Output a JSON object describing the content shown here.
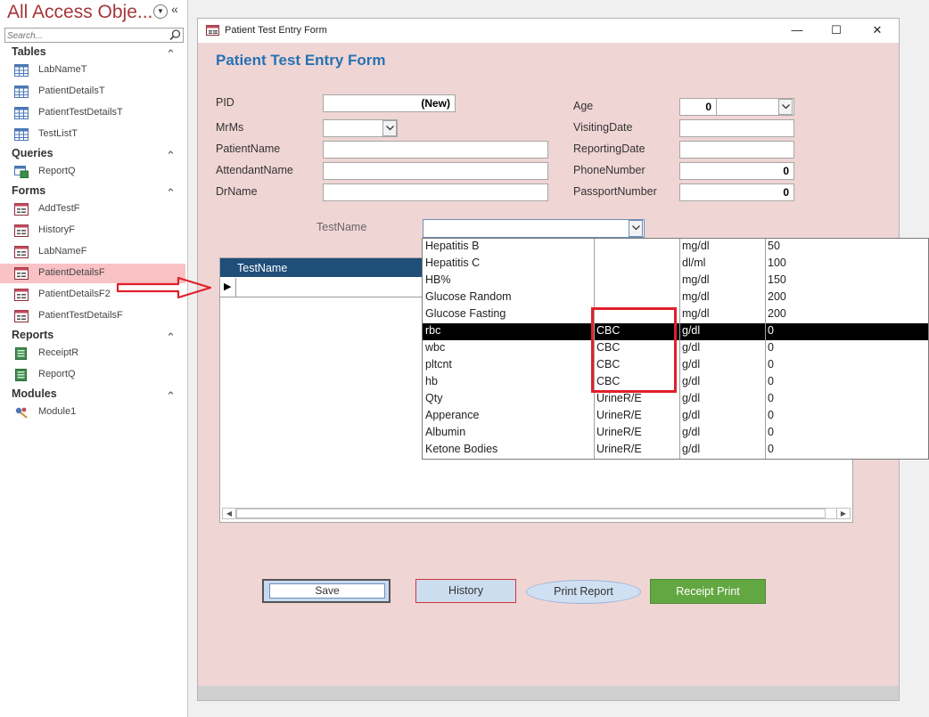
{
  "nav": {
    "title": "All Access Obje...",
    "search_placeholder": "Search...",
    "groups": [
      {
        "label": "Tables",
        "items": [
          "LabNameT",
          "PatientDetailsT",
          "PatientTestDetailsT",
          "TestListT"
        ]
      },
      {
        "label": "Queries",
        "items": [
          "ReportQ"
        ]
      },
      {
        "label": "Forms",
        "items": [
          "AddTestF",
          "HistoryF",
          "LabNameF",
          "PatientDetailsF",
          "PatientDetailsF2",
          "PatientTestDetailsF"
        ]
      },
      {
        "label": "Reports",
        "items": [
          "ReceiptR",
          "ReportQ"
        ]
      },
      {
        "label": "Modules",
        "items": [
          "Module1"
        ]
      }
    ],
    "selected_item": "PatientDetailsF"
  },
  "window": {
    "title": "Patient Test Entry Form",
    "min": "—",
    "max": "☐",
    "close": "✕"
  },
  "form": {
    "heading": "Patient Test Entry Form",
    "labels": {
      "pid": "PID",
      "mrms": "MrMs",
      "patientname": "PatientName",
      "attendantname": "AttendantName",
      "drname": "DrName",
      "age": "Age",
      "visitingdate": "VisitingDate",
      "reportingdate": "ReportingDate",
      "phonenumber": "PhoneNumber",
      "passportnumber": "PassportNumber",
      "testname": "TestName"
    },
    "values": {
      "pid": "(New)",
      "age": "0",
      "phonenumber": "0",
      "passportnumber": "0"
    }
  },
  "subform": {
    "column_header": "TestName",
    "row_marker": "▶"
  },
  "dropdown": {
    "rows": [
      [
        "Hepatitis B",
        "",
        "mg/dl",
        "50"
      ],
      [
        "Hepatitis C",
        "",
        "dl/ml",
        "100"
      ],
      [
        "HB%",
        "",
        "mg/dl",
        "150"
      ],
      [
        "Glucose Random",
        "",
        "mg/dl",
        "200"
      ],
      [
        "Glucose Fasting",
        "",
        "mg/dl",
        "200"
      ],
      [
        "rbc",
        "CBC",
        "g/dl",
        "0"
      ],
      [
        "wbc",
        "CBC",
        "g/dl",
        "0"
      ],
      [
        "pltcnt",
        "CBC",
        "g/dl",
        "0"
      ],
      [
        "hb",
        "CBC",
        "g/dl",
        "0"
      ],
      [
        "Qty",
        "UrineR/E",
        "g/dl",
        "0"
      ],
      [
        "Apperance",
        "UrineR/E",
        "g/dl",
        "0"
      ],
      [
        "Albumin",
        "UrineR/E",
        "g/dl",
        "0"
      ],
      [
        "Ketone Bodies",
        "UrineR/E",
        "g/dl",
        "0"
      ]
    ],
    "selected_index": 5
  },
  "buttons": {
    "save": "Save",
    "history": "History",
    "print_report": "Print Report",
    "receipt_print": "Receipt Print"
  },
  "colors": {
    "accent": "#2672b3",
    "form_bg": "#f0d5d5",
    "highlight": "#e0202a",
    "receipt_green": "#63a743"
  }
}
